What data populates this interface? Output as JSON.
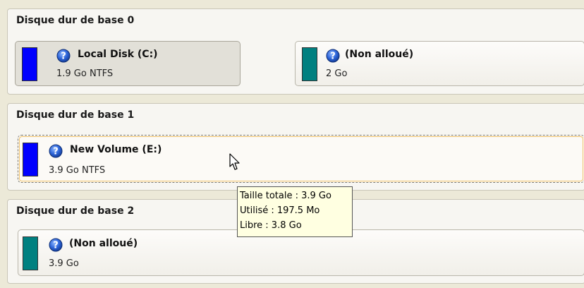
{
  "disks": [
    {
      "title": "Disque dur de base 0",
      "partitions": [
        {
          "name": "Local Disk (C:)",
          "size": "1.9 Go NTFS",
          "color": "#0000ff"
        },
        {
          "name": "(Non alloué)",
          "size": "2 Go",
          "color": "#008080"
        }
      ]
    },
    {
      "title": "Disque dur de base 1",
      "partitions": [
        {
          "name": "New Volume (E:)",
          "size": "3.9 Go NTFS",
          "color": "#0000ff"
        }
      ]
    },
    {
      "title": "Disque dur de base 2",
      "partitions": [
        {
          "name": "(Non alloué)",
          "size": "3.9 Go",
          "color": "#008080"
        }
      ]
    }
  ],
  "tooltip": {
    "total": "Taille totale : 3.9 Go",
    "used": "Utilisé : 197.5 Mo",
    "free": "Libre : 3.8 Go"
  },
  "icons": {
    "help": "question-icon",
    "cursor": "mouse-cursor-icon"
  }
}
